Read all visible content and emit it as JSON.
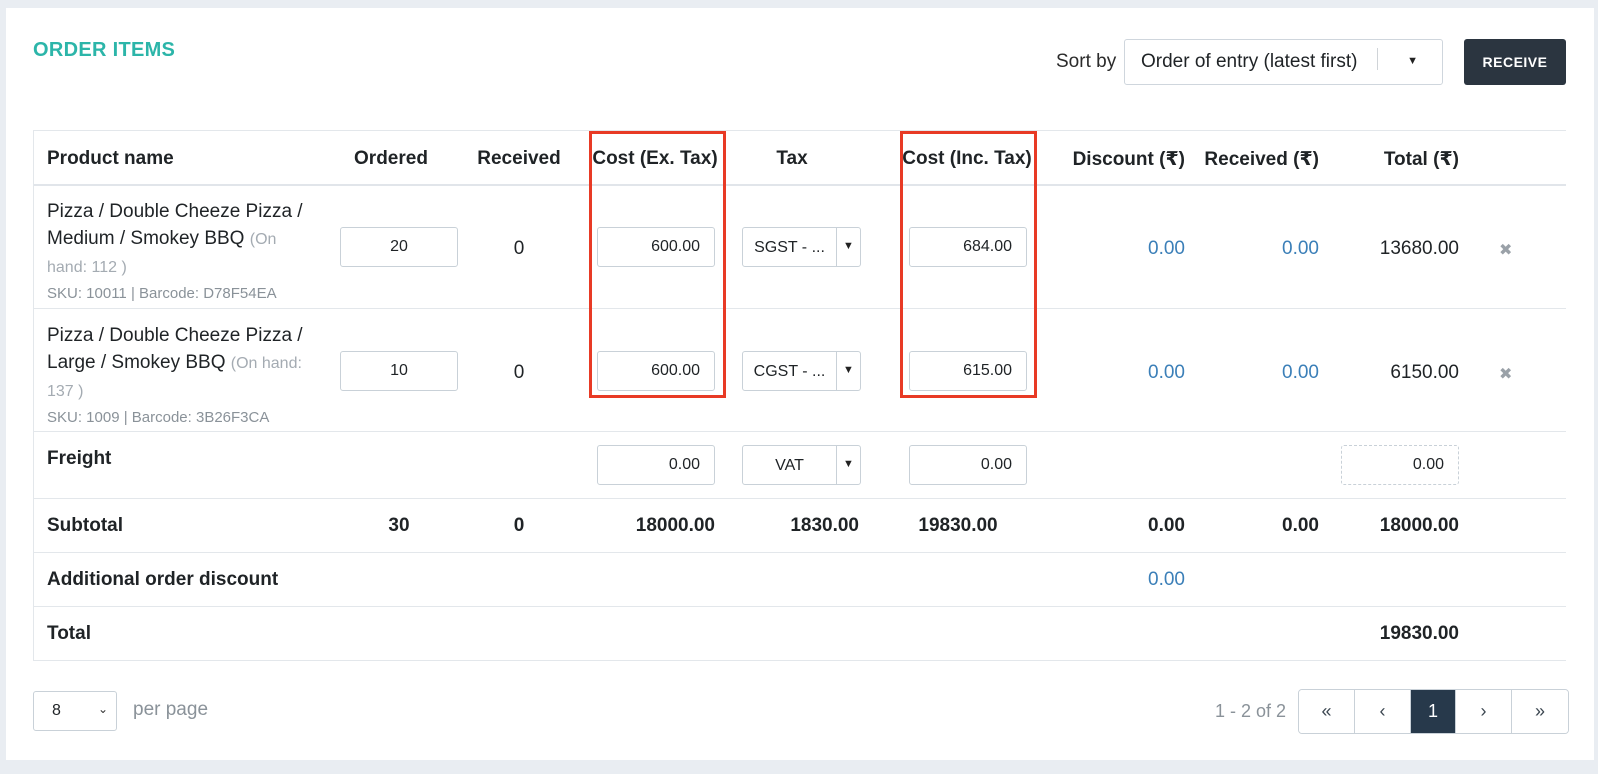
{
  "header": {
    "title": "ORDER ITEMS",
    "sort_label": "Sort by",
    "sort_value": "Order of entry (latest first)",
    "receive_label": "RECEIVE"
  },
  "columns": {
    "product": "Product name",
    "ordered": "Ordered",
    "received": "Received",
    "cost_ex": "Cost (Ex. Tax)",
    "tax": "Tax",
    "cost_inc": "Cost (Inc. Tax)",
    "discount": "Discount (₹)",
    "received_amt": "Received (₹)",
    "total": "Total (₹)"
  },
  "items": [
    {
      "name": "Pizza / Double Cheeze Pizza / Medium / Smokey BBQ",
      "on_hand": "(On hand: 112 )",
      "meta": "SKU: 10011 | Barcode: D78F54EA",
      "ordered": "20",
      "received": "0",
      "cost_ex": "600.00",
      "tax": "SGST - ...",
      "cost_inc": "684.00",
      "discount": "0.00",
      "received_amt": "0.00",
      "total": "13680.00"
    },
    {
      "name": "Pizza / Double Cheeze Pizza / Large / Smokey BBQ",
      "on_hand": "(On hand: 137 )",
      "meta": "SKU: 1009 | Barcode: 3B26F3CA",
      "ordered": "10",
      "received": "0",
      "cost_ex": "600.00",
      "tax": "CGST - ...",
      "cost_inc": "615.00",
      "discount": "0.00",
      "received_amt": "0.00",
      "total": "6150.00"
    }
  ],
  "freight": {
    "label": "Freight",
    "cost_ex": "0.00",
    "tax": "VAT",
    "cost_inc": "0.00",
    "total": "0.00"
  },
  "subtotal": {
    "label": "Subtotal",
    "ordered": "30",
    "received": "0",
    "cost_ex": "18000.00",
    "tax": "1830.00",
    "cost_inc": "19830.00",
    "discount": "0.00",
    "received_amt": "0.00",
    "total": "18000.00"
  },
  "additional_discount": {
    "label": "Additional order discount",
    "value": "0.00"
  },
  "grand_total": {
    "label": "Total",
    "value": "19830.00"
  },
  "pagination": {
    "per_page_value": "8",
    "per_page_label": "per page",
    "range": "1 - 2 of 2",
    "first": "«",
    "prev": "‹",
    "current": "1",
    "next": "›",
    "last": "»"
  },
  "icons": {
    "delete": "✖",
    "caret": "▼",
    "chevron": "⌄"
  },
  "colors": {
    "title": "#2cb5a9",
    "link": "#3b7fb8",
    "highlight": "#e83a25",
    "button": "#2b3540"
  }
}
